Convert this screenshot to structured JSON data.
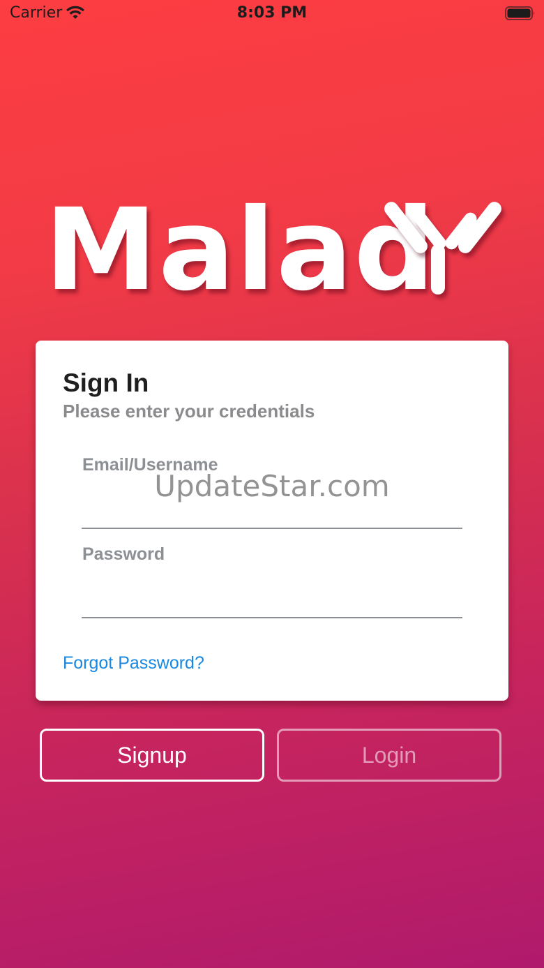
{
  "status_bar": {
    "carrier": "Carrier",
    "time": "8:03 PM",
    "icons": [
      "wifi-icon",
      "battery-icon"
    ]
  },
  "logo": {
    "text": "Malad",
    "icon": "antibody-icon"
  },
  "card": {
    "title": "Sign In",
    "subtitle": "Please enter your credentials",
    "email_field": {
      "label": "Email/Username",
      "value": ""
    },
    "password_field": {
      "label": "Password",
      "value": ""
    },
    "forgot_password": "Forgot Password?"
  },
  "buttons": {
    "signup": "Signup",
    "login": "Login"
  },
  "watermark": "UpdateStar.com",
  "colors": {
    "background_top": "#fd3d42",
    "background_bottom": "#b01a6c",
    "link": "#1a88e0",
    "label": "#8c9094"
  }
}
